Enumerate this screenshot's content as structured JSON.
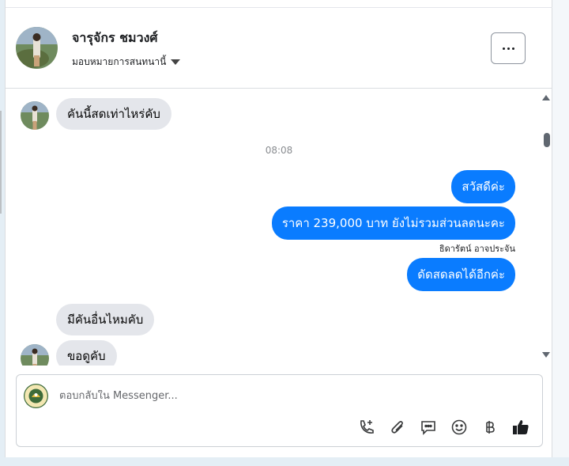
{
  "header": {
    "contact_name": "จารุจักร ชมวงศ์",
    "assign_label": "มอบหมายการสนทนานี้"
  },
  "thread": {
    "timestamp": "08:08",
    "sender_label": "ธิดารัตน์ อาจประจัน",
    "messages": [
      {
        "direction": "in",
        "text": "คันนี้สดเท่าไหร่คับ"
      },
      {
        "direction": "out",
        "text": "สวัสดีค่ะ"
      },
      {
        "direction": "out",
        "text": "ราคา 239,000 บาท ยังไม่รวมส่วนลดนะคะ"
      },
      {
        "direction": "out",
        "text": "ดัดสดลดได้อีกค่ะ"
      },
      {
        "direction": "in",
        "text": "มีคันอื่นไหมคับ"
      },
      {
        "direction": "in",
        "text": "ขอดูคับ"
      }
    ]
  },
  "composer": {
    "placeholder": "ตอบกลับใน Messenger..."
  },
  "icons": {
    "more": "more-options-icon",
    "call": "phone-add-icon",
    "attach": "paperclip-icon",
    "saved_replies": "chat-bubble-icon",
    "emoji": "emoji-icon",
    "payment": "baht-icon",
    "like": "thumbs-up-icon"
  },
  "colors": {
    "outgoing_bubble": "#0a7cff",
    "incoming_bubble": "#e4e6eb"
  }
}
